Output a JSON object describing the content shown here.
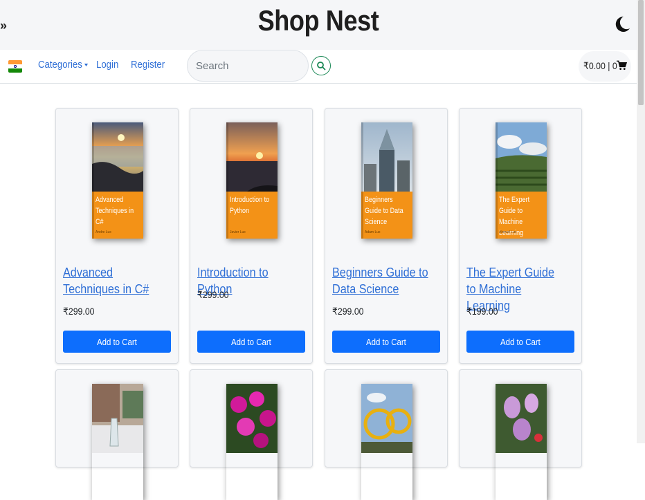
{
  "header": {
    "title": "Shop Nest",
    "sidebar_toggle": "»",
    "theme_icon": "moon-icon"
  },
  "navbar": {
    "flag_icon": "india-flag-icon",
    "categories": "Categories",
    "login": "Login",
    "register": "Register",
    "search_placeholder": "Search",
    "search_icon": "search-icon",
    "cart_summary": "₹0.00 | 0",
    "cart_icon": "cart-icon"
  },
  "colors": {
    "link": "#2f6fd6",
    "button": "#0d6efd",
    "search_border": "#198754",
    "cover_orange": "#f39217"
  },
  "products": [
    {
      "title": "Advanced Techniques in C#",
      "cover_title": "Advanced Techniques in C#",
      "cover_author": "Andre Lux",
      "price": "₹299.00",
      "button": "Add to Cart"
    },
    {
      "title": "Introduction to Python",
      "cover_title": "Introduction to Python",
      "cover_author": "Javier Lux",
      "price": "₹299.00",
      "button": "Add to Cart"
    },
    {
      "title": "Beginners Guide to Data Science",
      "cover_title": "Beginners Guide to Data Science",
      "cover_author": "Adam Lux",
      "price": "₹299.00",
      "button": "Add to Cart"
    },
    {
      "title": "The Expert Guide to Machine Learning",
      "cover_title": "The Expert Guide to Machine Learning",
      "cover_author": "Ahmad Lux",
      "price": "₹199.00",
      "button": "Add to Cart"
    }
  ]
}
